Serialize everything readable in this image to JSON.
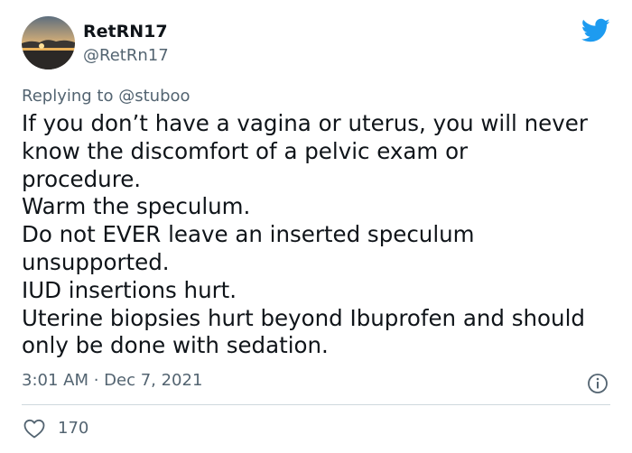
{
  "author": {
    "display_name": "RetRN17",
    "handle": "@RetRn17"
  },
  "reply": {
    "prefix": "Replying to",
    "to_handle": "@stuboo"
  },
  "tweet": {
    "lines": [
      "If you don’t have a vagina or uterus, you will never",
      "know the discomfort of a pelvic exam or",
      "procedure.",
      "Warm the speculum.",
      "Do not EVER leave an inserted speculum",
      "unsupported.",
      "IUD insertions hurt.",
      "Uterine biopsies hurt beyond Ibuprofen and should",
      "only be done with sedation."
    ],
    "timestamp": "3:01 AM · Dec 7, 2021"
  },
  "engagement": {
    "likes": "170"
  },
  "icons": {
    "brand": "twitter-bird-icon",
    "info": "info-icon",
    "like": "heart-icon"
  },
  "colors": {
    "brand_blue": "#1d9bf0",
    "text_primary": "#0f1419",
    "text_secondary": "#536471",
    "divider": "#cfd9de"
  }
}
